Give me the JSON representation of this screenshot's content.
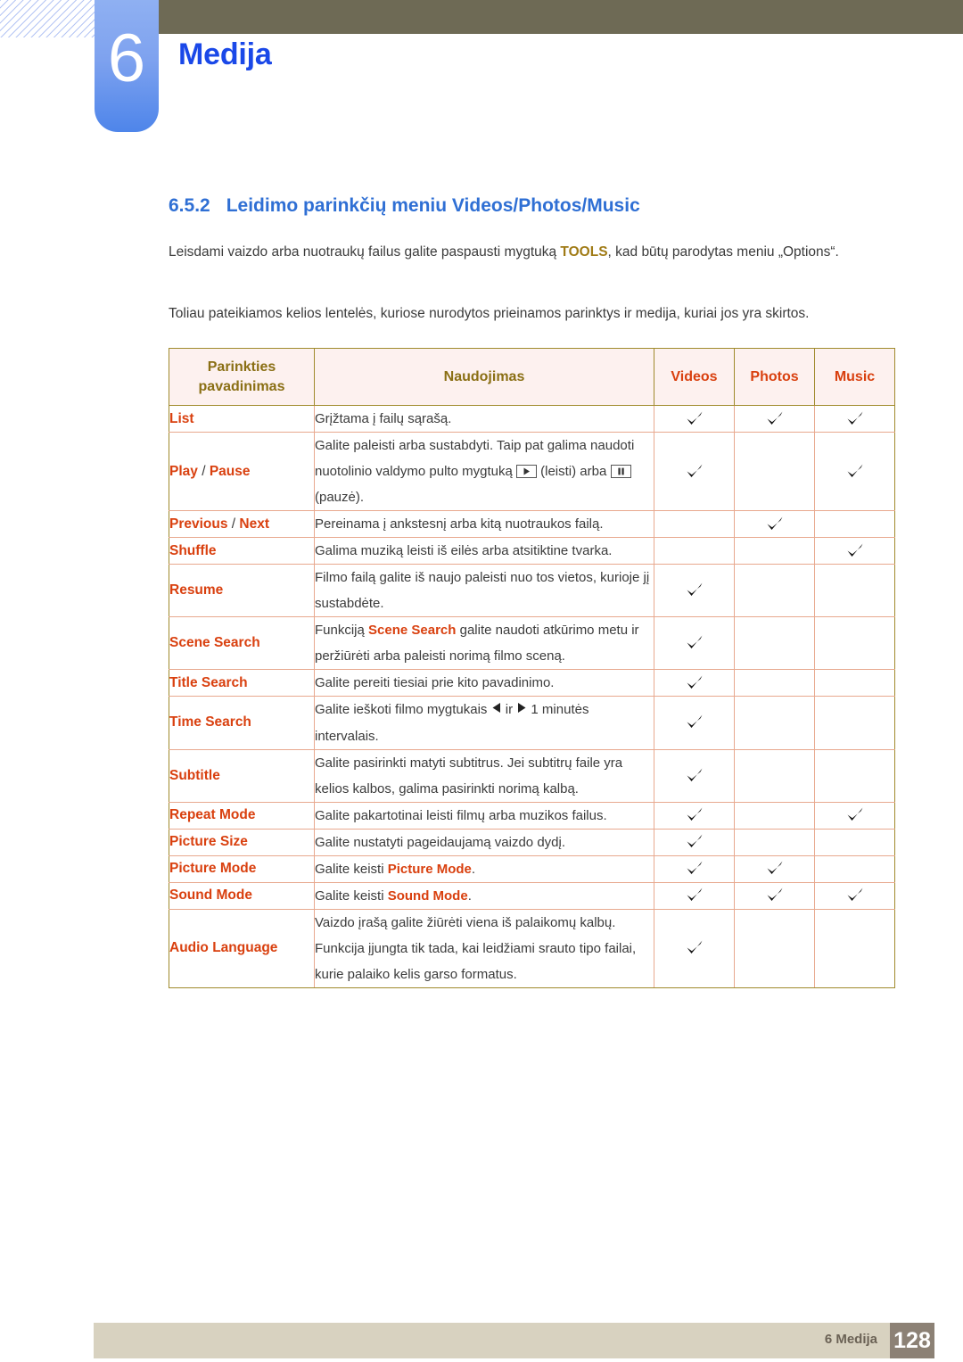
{
  "chapter": {
    "number": "6",
    "title": "Medija"
  },
  "section": {
    "number": "6.5.2",
    "title": "Leidimo parinkčių meniu Videos/Photos/Music"
  },
  "paragraphs": {
    "p1_before": "Leisdami vaizdo arba nuotraukų failus galite paspausti mygtuką ",
    "p1_highlight": "TOOLS",
    "p1_after": ", kad būtų parodytas meniu „Options“.",
    "p2": "Toliau pateikiamos kelios lentelės, kuriose nurodytos prieinamos parinktys ir medija, kuriai jos yra skirtos."
  },
  "table": {
    "headers": {
      "name": "Parinkties pavadinimas",
      "usage": "Naudojimas",
      "videos": "Videos",
      "photos": "Photos",
      "music": "Music"
    },
    "rows": [
      {
        "name": "List",
        "usage": "Grįžtama į failų sąrašą.",
        "videos": true,
        "photos": true,
        "music": true
      },
      {
        "name": "Play / Pause",
        "name_part1": "Play",
        "name_sep": " / ",
        "name_part2": "Pause",
        "usage_a": "Galite paleisti arba sustabdyti. Taip pat galima naudoti nuotolinio valdymo pulto mygtuką ",
        "usage_b": " (leisti) arba ",
        "usage_c": " (pauzė).",
        "videos": true,
        "photos": false,
        "music": true
      },
      {
        "name": "Previous / Next",
        "name_part1": "Previous",
        "name_sep": " / ",
        "name_part2": "Next",
        "usage": "Pereinama į ankstesnį arba kitą nuotraukos failą.",
        "videos": false,
        "photos": true,
        "music": false
      },
      {
        "name": "Shuffle",
        "usage": "Galima muziką leisti iš eilės arba atsitiktine tvarka.",
        "videos": false,
        "photos": false,
        "music": true
      },
      {
        "name": "Resume",
        "usage": "Filmo failą galite iš naujo paleisti nuo tos vietos, kurioje jį sustabdėte.",
        "videos": true,
        "photos": false,
        "music": false
      },
      {
        "name": "Scene Search",
        "usage_a": "Funkciją ",
        "usage_kw": "Scene Search",
        "usage_b": " galite naudoti atkūrimo metu ir peržiūrėti arba paleisti norimą filmo sceną.",
        "videos": true,
        "photos": false,
        "music": false
      },
      {
        "name": "Title Search",
        "usage": "Galite pereiti tiesiai prie kito pavadinimo.",
        "videos": true,
        "photos": false,
        "music": false
      },
      {
        "name": "Time Search",
        "usage_a": "Galite ieškoti filmo mygtukais ",
        "usage_b": " ir ",
        "usage_c": " 1 minutės intervalais.",
        "videos": true,
        "photos": false,
        "music": false
      },
      {
        "name": "Subtitle",
        "usage": "Galite pasirinkti matyti subtitrus. Jei subtitrų faile yra kelios kalbos, galima pasirinkti norimą kalbą.",
        "videos": true,
        "photos": false,
        "music": false
      },
      {
        "name": "Repeat Mode",
        "usage": "Galite pakartotinai leisti filmų arba muzikos failus.",
        "videos": true,
        "photos": false,
        "music": true
      },
      {
        "name": "Picture Size",
        "usage": "Galite nustatyti pageidaujamą vaizdo dydį.",
        "videos": true,
        "photos": false,
        "music": false
      },
      {
        "name": "Picture Mode",
        "usage_a": "Galite keisti ",
        "usage_kw": "Picture Mode",
        "usage_b": ".",
        "videos": true,
        "photos": true,
        "music": false
      },
      {
        "name": "Sound Mode",
        "usage_a": "Galite keisti ",
        "usage_kw": "Sound Mode",
        "usage_b": ".",
        "videos": true,
        "photos": true,
        "music": true
      },
      {
        "name": "Audio Language",
        "usage": "Vaizdo įrašą galite žiūrėti viena iš palaikomų kalbų. Funkcija įjungta tik tada, kai leidžiami srauto tipo failai, kurie palaiko kelis garso formatus.",
        "videos": true,
        "photos": false,
        "music": false
      }
    ]
  },
  "footer": {
    "label": "6 Medija",
    "page": "128"
  },
  "icons": {
    "play": "play-button-icon",
    "pause": "pause-button-icon",
    "left_arrow": "left-arrow-icon",
    "right_arrow": "right-arrow-icon",
    "check": "check-icon"
  },
  "colors": {
    "banner": "#6e6a55",
    "chapter_tab": "#5f8bec",
    "chapter_title": "#1a48e8",
    "section_heading": "#2f6fd4",
    "table_header_bg": "#fdf1ef",
    "table_border_outer": "#a08a2c",
    "table_border_inner": "#e8a98f",
    "keyword": "#d9400f",
    "brand_highlight": "#a07b16",
    "footer_bar": "#d8d2c0",
    "footer_page_bg": "#8c8175"
  }
}
